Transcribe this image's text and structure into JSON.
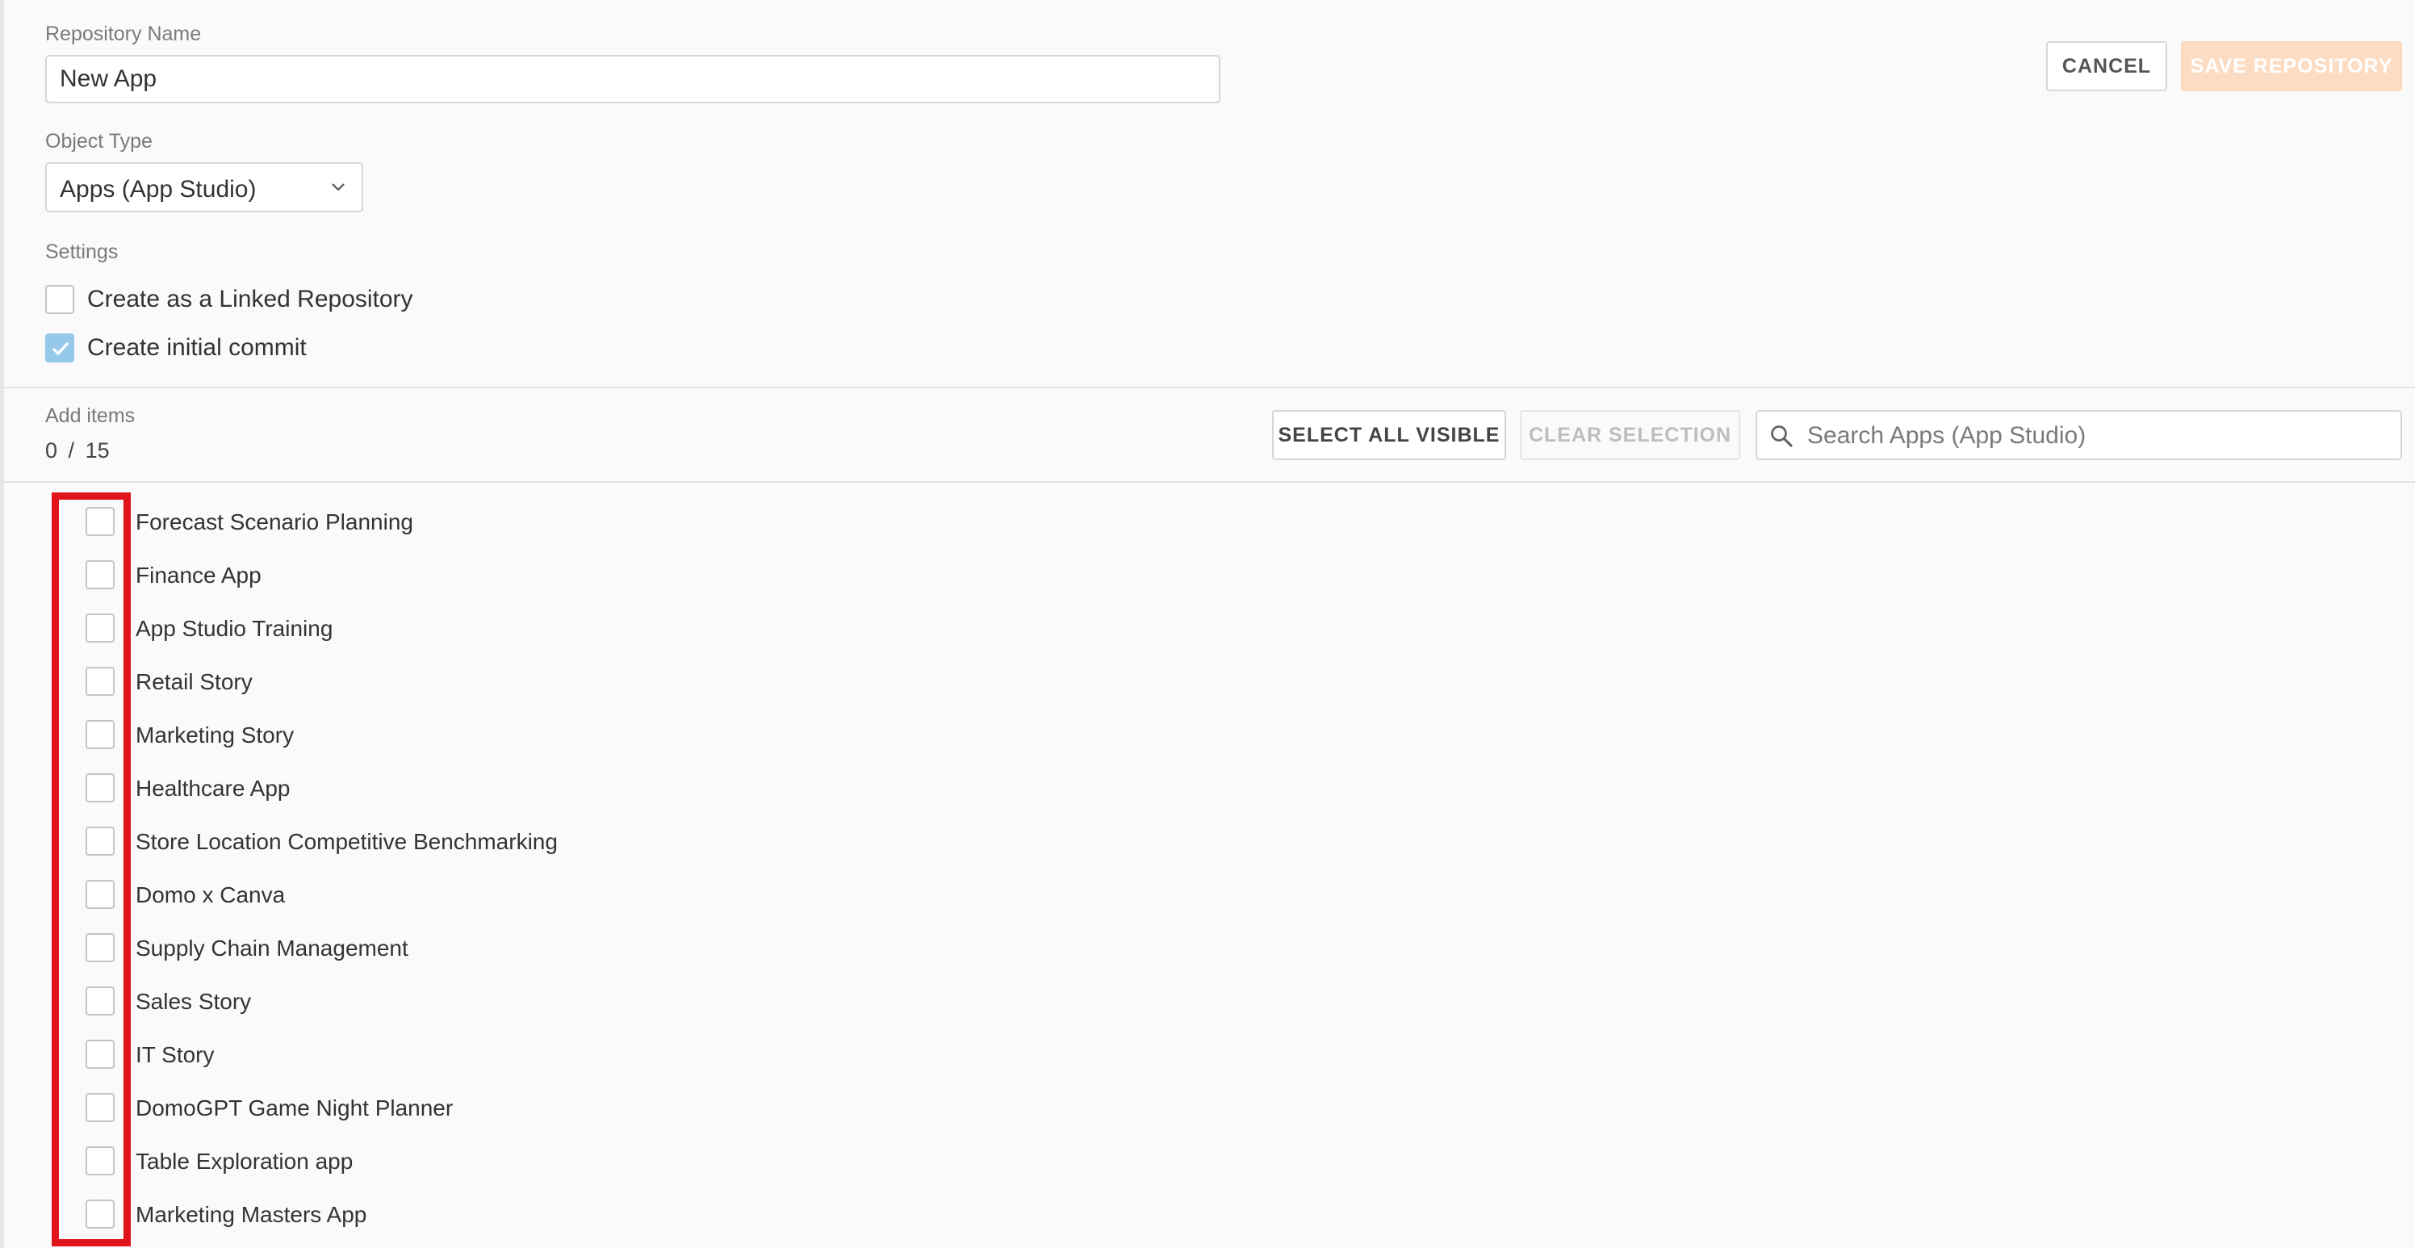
{
  "form": {
    "repo_name_label": "Repository Name",
    "repo_name_value": "New App",
    "object_type_label": "Object Type",
    "object_type_value": "Apps (App Studio)",
    "settings_label": "Settings",
    "linked_repo_label": "Create as a Linked Repository",
    "linked_repo_checked": false,
    "initial_commit_label": "Create initial commit",
    "initial_commit_checked": true
  },
  "actions": {
    "cancel_label": "CANCEL",
    "save_label": "SAVE REPOSITORY",
    "save_enabled": false
  },
  "items_section": {
    "title": "Add items",
    "selected_count": "0",
    "separator": "/",
    "total_count": "15",
    "select_all_label": "SELECT ALL VISIBLE",
    "clear_selection_label": "CLEAR SELECTION",
    "search_placeholder": "Search Apps (App Studio)"
  },
  "items": [
    {
      "label": "Forecast Scenario Planning",
      "checked": false
    },
    {
      "label": "Finance App",
      "checked": false
    },
    {
      "label": "App Studio Training",
      "checked": false
    },
    {
      "label": "Retail Story",
      "checked": false
    },
    {
      "label": "Marketing Story",
      "checked": false
    },
    {
      "label": "Healthcare App",
      "checked": false
    },
    {
      "label": "Store Location Competitive Benchmarking",
      "checked": false
    },
    {
      "label": "Domo x Canva",
      "checked": false
    },
    {
      "label": "Supply Chain Management",
      "checked": false
    },
    {
      "label": "Sales Story",
      "checked": false
    },
    {
      "label": "IT Story",
      "checked": false
    },
    {
      "label": "DomoGPT Game Night Planner",
      "checked": false
    },
    {
      "label": "Table Exploration app",
      "checked": false
    },
    {
      "label": "Marketing Masters App",
      "checked": false
    }
  ],
  "colors": {
    "accent_checked": "#96c8ea",
    "save_disabled": "#fcdcc2",
    "highlight_outline": "#e0141b"
  }
}
